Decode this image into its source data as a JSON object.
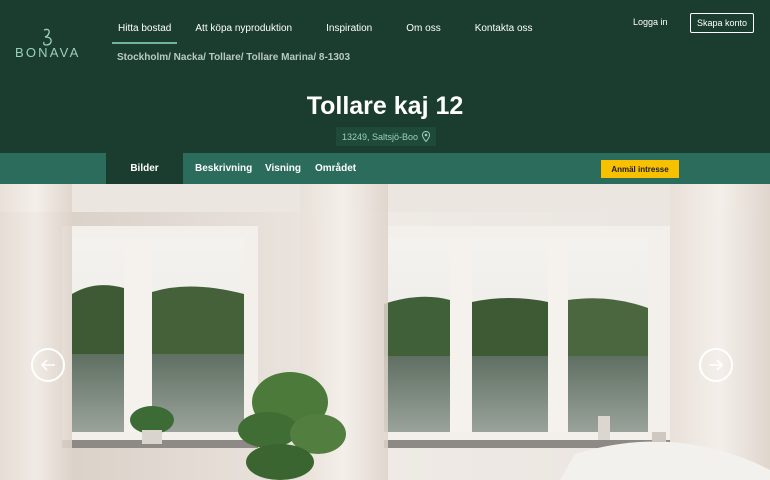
{
  "brand": {
    "name": "BONAVA"
  },
  "nav": {
    "items": [
      {
        "label": "Hitta bostad",
        "active": true
      },
      {
        "label": "Att köpa nyproduktion"
      },
      {
        "label": "Inspiration"
      },
      {
        "label": "Om oss"
      },
      {
        "label": "Kontakta oss"
      }
    ],
    "login_label": "Logga in",
    "signup_label": "Skapa konto"
  },
  "breadcrumb": "Stockholm/ Nacka/ Tollare/ Tollare Marina/ 8-1303",
  "listing": {
    "title": "Tollare kaj 12",
    "address": "13249, Saltsjö-Boo"
  },
  "tabs": {
    "items": [
      "Bilder",
      "Beskrivning",
      "Visning",
      "Området"
    ],
    "cta_label": "Anmäl intresse"
  },
  "colors": {
    "brand_green": "#1b3d30",
    "subnav_green": "#2c6c5c",
    "accent_yellow": "#f8c100",
    "logo_mint": "#9bd1b9"
  },
  "icons": {
    "location": "map-pin-icon",
    "prev": "arrow-left-circle-icon",
    "next": "arrow-right-circle-icon"
  }
}
